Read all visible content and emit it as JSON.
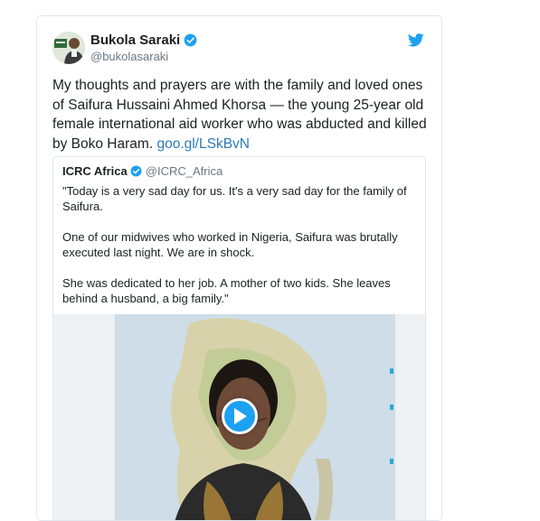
{
  "tweet": {
    "display_name": "Bukola Saraki",
    "handle": "@bukolasaraki",
    "text": "My thoughts and prayers are with the family and loved ones of Saifura Hussaini Ahmed Khorsa — the young 25-year old female international aid worker who was abducted and killed by Boko Haram.",
    "link": "goo.gl/LSkBvN"
  },
  "quoted": {
    "display_name": "ICRC Africa",
    "handle": "@ICRC_Africa",
    "paragraphs": [
      "\"Today is a very sad day for us. It's a very sad day for the family of Saifura.",
      "One of our midwives who worked in Nigeria, Saifura was brutally executed last night. We are in shock.",
      "She was dedicated to her job. A mother of two kids. She leaves behind a husband, a big family.\""
    ]
  },
  "icons": {
    "verified": "verified-badge-icon",
    "bird": "twitter-bird-icon",
    "play": "play-icon"
  },
  "colors": {
    "accent": "#1da1f2",
    "link": "#2b7bb9",
    "muted": "#697882"
  }
}
